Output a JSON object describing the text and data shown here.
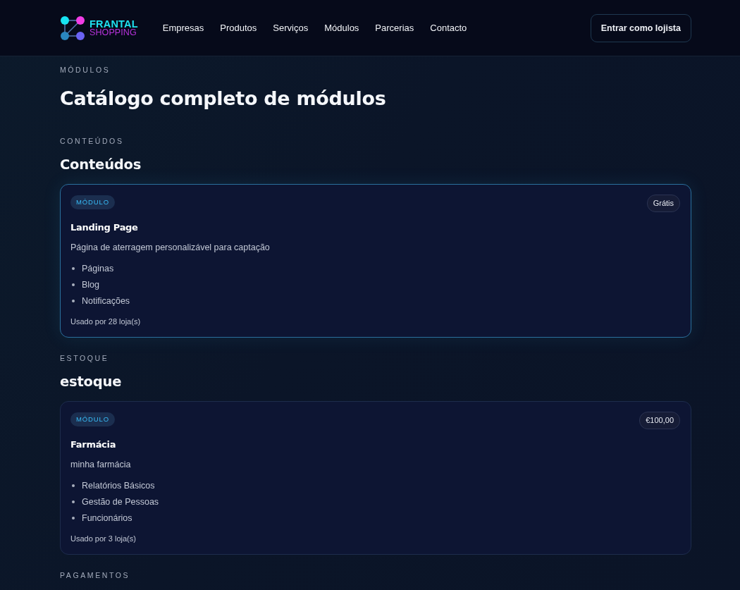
{
  "header": {
    "logo": {
      "line_1": "FRANTAL",
      "line_2": "SHOPPING"
    },
    "nav": [
      {
        "label": "Empresas"
      },
      {
        "label": "Produtos"
      },
      {
        "label": "Serviços"
      },
      {
        "label": "Módulos"
      },
      {
        "label": "Parcerias"
      },
      {
        "label": "Contacto"
      }
    ],
    "cta": "Entrar como lojista"
  },
  "page": {
    "eyebrow": "MÓDULOS",
    "title": "Catálogo completo de módulos"
  },
  "sections": [
    {
      "eyebrow": "CONTEÚDOS",
      "title": "Conteúdos",
      "modules": [
        {
          "badge": "MÓDULO",
          "price": "Grátis",
          "name": "Landing Page",
          "description": "Página de aterragem personalizável para captação",
          "features": [
            "Páginas",
            "Blog",
            "Notificações"
          ],
          "usage": "Usado por 28 loja(s)",
          "highlighted": true
        }
      ]
    },
    {
      "eyebrow": "ESTOQUE",
      "title": "estoque",
      "modules": [
        {
          "badge": "MÓDULO",
          "price": "€100,00",
          "name": "Farmácia",
          "description": "minha farmácia",
          "features": [
            "Relatórios Básicos",
            "Gestão de Pessoas",
            "Funcionários"
          ],
          "usage": "Usado por 3 loja(s)",
          "highlighted": false
        }
      ]
    },
    {
      "eyebrow": "PAGAMENTOS"
    }
  ]
}
